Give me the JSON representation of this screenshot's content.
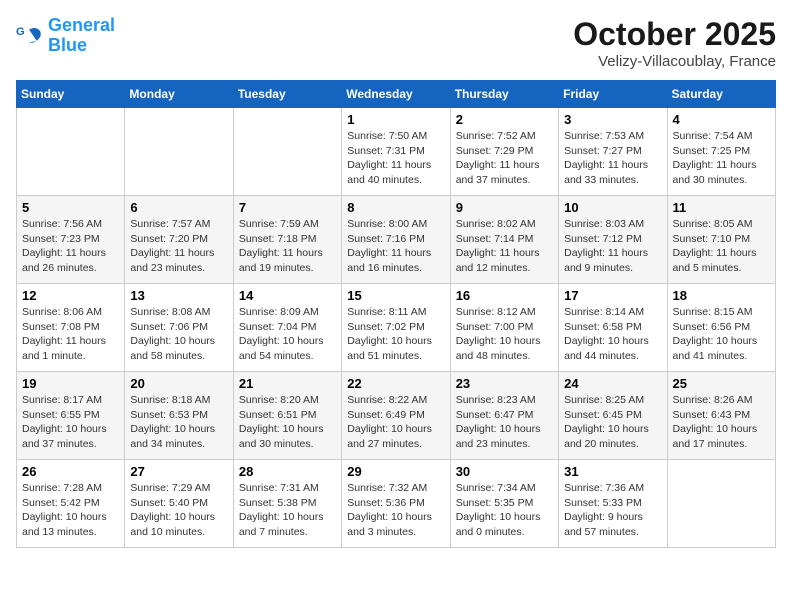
{
  "header": {
    "logo_general": "General",
    "logo_blue": "Blue",
    "month_title": "October 2025",
    "location": "Velizy-Villacoublay, France"
  },
  "weekdays": [
    "Sunday",
    "Monday",
    "Tuesday",
    "Wednesday",
    "Thursday",
    "Friday",
    "Saturday"
  ],
  "weeks": [
    [
      {
        "day": "",
        "sunrise": "",
        "sunset": "",
        "daylight": ""
      },
      {
        "day": "",
        "sunrise": "",
        "sunset": "",
        "daylight": ""
      },
      {
        "day": "",
        "sunrise": "",
        "sunset": "",
        "daylight": ""
      },
      {
        "day": "1",
        "sunrise": "Sunrise: 7:50 AM",
        "sunset": "Sunset: 7:31 PM",
        "daylight": "Daylight: 11 hours and 40 minutes."
      },
      {
        "day": "2",
        "sunrise": "Sunrise: 7:52 AM",
        "sunset": "Sunset: 7:29 PM",
        "daylight": "Daylight: 11 hours and 37 minutes."
      },
      {
        "day": "3",
        "sunrise": "Sunrise: 7:53 AM",
        "sunset": "Sunset: 7:27 PM",
        "daylight": "Daylight: 11 hours and 33 minutes."
      },
      {
        "day": "4",
        "sunrise": "Sunrise: 7:54 AM",
        "sunset": "Sunset: 7:25 PM",
        "daylight": "Daylight: 11 hours and 30 minutes."
      }
    ],
    [
      {
        "day": "5",
        "sunrise": "Sunrise: 7:56 AM",
        "sunset": "Sunset: 7:23 PM",
        "daylight": "Daylight: 11 hours and 26 minutes."
      },
      {
        "day": "6",
        "sunrise": "Sunrise: 7:57 AM",
        "sunset": "Sunset: 7:20 PM",
        "daylight": "Daylight: 11 hours and 23 minutes."
      },
      {
        "day": "7",
        "sunrise": "Sunrise: 7:59 AM",
        "sunset": "Sunset: 7:18 PM",
        "daylight": "Daylight: 11 hours and 19 minutes."
      },
      {
        "day": "8",
        "sunrise": "Sunrise: 8:00 AM",
        "sunset": "Sunset: 7:16 PM",
        "daylight": "Daylight: 11 hours and 16 minutes."
      },
      {
        "day": "9",
        "sunrise": "Sunrise: 8:02 AM",
        "sunset": "Sunset: 7:14 PM",
        "daylight": "Daylight: 11 hours and 12 minutes."
      },
      {
        "day": "10",
        "sunrise": "Sunrise: 8:03 AM",
        "sunset": "Sunset: 7:12 PM",
        "daylight": "Daylight: 11 hours and 9 minutes."
      },
      {
        "day": "11",
        "sunrise": "Sunrise: 8:05 AM",
        "sunset": "Sunset: 7:10 PM",
        "daylight": "Daylight: 11 hours and 5 minutes."
      }
    ],
    [
      {
        "day": "12",
        "sunrise": "Sunrise: 8:06 AM",
        "sunset": "Sunset: 7:08 PM",
        "daylight": "Daylight: 11 hours and 1 minute."
      },
      {
        "day": "13",
        "sunrise": "Sunrise: 8:08 AM",
        "sunset": "Sunset: 7:06 PM",
        "daylight": "Daylight: 10 hours and 58 minutes."
      },
      {
        "day": "14",
        "sunrise": "Sunrise: 8:09 AM",
        "sunset": "Sunset: 7:04 PM",
        "daylight": "Daylight: 10 hours and 54 minutes."
      },
      {
        "day": "15",
        "sunrise": "Sunrise: 8:11 AM",
        "sunset": "Sunset: 7:02 PM",
        "daylight": "Daylight: 10 hours and 51 minutes."
      },
      {
        "day": "16",
        "sunrise": "Sunrise: 8:12 AM",
        "sunset": "Sunset: 7:00 PM",
        "daylight": "Daylight: 10 hours and 48 minutes."
      },
      {
        "day": "17",
        "sunrise": "Sunrise: 8:14 AM",
        "sunset": "Sunset: 6:58 PM",
        "daylight": "Daylight: 10 hours and 44 minutes."
      },
      {
        "day": "18",
        "sunrise": "Sunrise: 8:15 AM",
        "sunset": "Sunset: 6:56 PM",
        "daylight": "Daylight: 10 hours and 41 minutes."
      }
    ],
    [
      {
        "day": "19",
        "sunrise": "Sunrise: 8:17 AM",
        "sunset": "Sunset: 6:55 PM",
        "daylight": "Daylight: 10 hours and 37 minutes."
      },
      {
        "day": "20",
        "sunrise": "Sunrise: 8:18 AM",
        "sunset": "Sunset: 6:53 PM",
        "daylight": "Daylight: 10 hours and 34 minutes."
      },
      {
        "day": "21",
        "sunrise": "Sunrise: 8:20 AM",
        "sunset": "Sunset: 6:51 PM",
        "daylight": "Daylight: 10 hours and 30 minutes."
      },
      {
        "day": "22",
        "sunrise": "Sunrise: 8:22 AM",
        "sunset": "Sunset: 6:49 PM",
        "daylight": "Daylight: 10 hours and 27 minutes."
      },
      {
        "day": "23",
        "sunrise": "Sunrise: 8:23 AM",
        "sunset": "Sunset: 6:47 PM",
        "daylight": "Daylight: 10 hours and 23 minutes."
      },
      {
        "day": "24",
        "sunrise": "Sunrise: 8:25 AM",
        "sunset": "Sunset: 6:45 PM",
        "daylight": "Daylight: 10 hours and 20 minutes."
      },
      {
        "day": "25",
        "sunrise": "Sunrise: 8:26 AM",
        "sunset": "Sunset: 6:43 PM",
        "daylight": "Daylight: 10 hours and 17 minutes."
      }
    ],
    [
      {
        "day": "26",
        "sunrise": "Sunrise: 7:28 AM",
        "sunset": "Sunset: 5:42 PM",
        "daylight": "Daylight: 10 hours and 13 minutes."
      },
      {
        "day": "27",
        "sunrise": "Sunrise: 7:29 AM",
        "sunset": "Sunset: 5:40 PM",
        "daylight": "Daylight: 10 hours and 10 minutes."
      },
      {
        "day": "28",
        "sunrise": "Sunrise: 7:31 AM",
        "sunset": "Sunset: 5:38 PM",
        "daylight": "Daylight: 10 hours and 7 minutes."
      },
      {
        "day": "29",
        "sunrise": "Sunrise: 7:32 AM",
        "sunset": "Sunset: 5:36 PM",
        "daylight": "Daylight: 10 hours and 3 minutes."
      },
      {
        "day": "30",
        "sunrise": "Sunrise: 7:34 AM",
        "sunset": "Sunset: 5:35 PM",
        "daylight": "Daylight: 10 hours and 0 minutes."
      },
      {
        "day": "31",
        "sunrise": "Sunrise: 7:36 AM",
        "sunset": "Sunset: 5:33 PM",
        "daylight": "Daylight: 9 hours and 57 minutes."
      },
      {
        "day": "",
        "sunrise": "",
        "sunset": "",
        "daylight": ""
      }
    ]
  ]
}
